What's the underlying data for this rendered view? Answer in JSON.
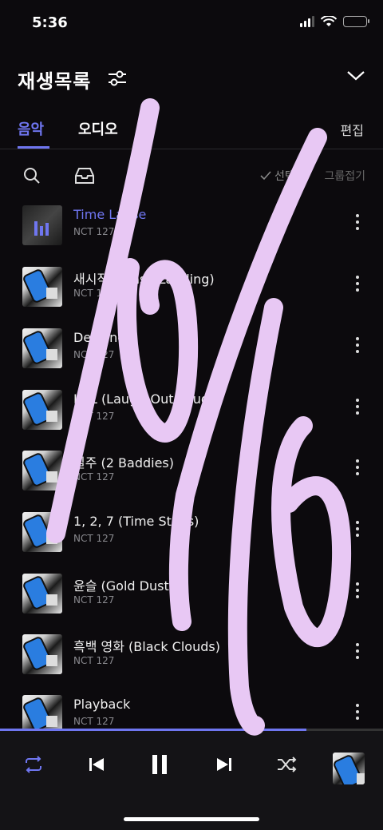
{
  "status": {
    "time": "5:36"
  },
  "header": {
    "title": "재생목록"
  },
  "tabs": [
    {
      "label": "음악",
      "active": true
    },
    {
      "label": "오디오",
      "active": false
    }
  ],
  "edit_label": "편집",
  "toolbar": {
    "select_all_label": "선택",
    "collapse_group_label": "그룹접기"
  },
  "tracks": [
    {
      "title": "Time Lapse",
      "artist": "NCT 127",
      "playing": true
    },
    {
      "title": "새시작 (Crash Landing)",
      "artist": "NCT 127"
    },
    {
      "title": "Designer",
      "artist": "NCT 127"
    },
    {
      "title": "LOL (Laugh-Out-Loud)",
      "artist": "NCT 127"
    },
    {
      "title": "질주 (2 Baddies)",
      "artist": "NCT 127"
    },
    {
      "title": "1, 2, 7 (Time Stops)",
      "artist": "NCT 127"
    },
    {
      "title": "윤슬 (Gold Dust)",
      "artist": "NCT 127"
    },
    {
      "title": "흑백 영화 (Black Clouds)",
      "artist": "NCT 127"
    },
    {
      "title": "Playback",
      "artist": "NCT 127"
    }
  ],
  "player": {
    "progress": 0.8
  },
  "colors": {
    "accent": "#6f76f0",
    "background": "#0c0a0d",
    "scribble": "#e8c8f4"
  },
  "icons": [
    "filter-icon",
    "chevron-down-icon",
    "search-icon",
    "inbox-icon",
    "check-icon",
    "more-vertical-icon",
    "repeat-icon",
    "previous-icon",
    "pause-icon",
    "next-icon",
    "shuffle-icon"
  ]
}
